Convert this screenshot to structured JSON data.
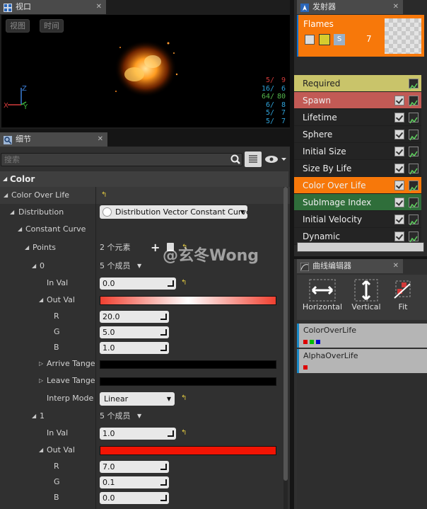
{
  "viewport": {
    "tab": "视口",
    "btn_view": "视图",
    "btn_time": "时间",
    "stats": [
      [
        "5/",
        "9",
        "#d23a3a"
      ],
      [
        "16/",
        "6",
        "#2fa3d9"
      ],
      [
        "64/",
        "80",
        "#54b84d"
      ],
      [
        "6/",
        "8",
        "#2fa3d9"
      ],
      [
        "5/",
        "7",
        "#2fa3d9"
      ],
      [
        "5/",
        "7",
        "#2fa3d9"
      ]
    ]
  },
  "details": {
    "tab": "细节",
    "search_placeholder": "搜索",
    "category": "Color",
    "color_over_life": "Color Over Life",
    "distribution": "Distribution",
    "distribution_value": "Distribution Vector Constant Curve",
    "constant_curve": "Constant Curve",
    "points": "Points",
    "points_value": "2 个元素",
    "p0": {
      "index": "0",
      "members": "5 个成员",
      "in_val_label": "In Val",
      "in_val": "0.0",
      "out_val_label": "Out Val",
      "r_label": "R",
      "r": "20.0",
      "g_label": "G",
      "g": "5.0",
      "b_label": "B",
      "b": "1.0",
      "arrive": "Arrive Tangent",
      "leave": "Leave Tangent",
      "interp_label": "Interp Mode",
      "interp": "Linear"
    },
    "p1": {
      "index": "1",
      "members": "5 个成员",
      "in_val_label": "In Val",
      "in_val": "1.0",
      "out_val_label": "Out Val",
      "r_label": "R",
      "r": "7.0",
      "g_label": "G",
      "g": "0.1",
      "b_label": "B",
      "b": "0.0"
    }
  },
  "emitter": {
    "tab": "发射器",
    "name": "Flames",
    "count": "7",
    "s_badge": "S",
    "modules": [
      "Required",
      "Spawn",
      "Lifetime",
      "Sphere",
      "Initial Size",
      "Size By Life",
      "Color Over Life",
      "SubImage Index",
      "Initial Velocity",
      "Dynamic"
    ]
  },
  "curve_editor": {
    "tab": "曲线编辑器",
    "horizontal": "Horizontal",
    "vertical": "Vertical",
    "fit": "Fit",
    "tracks": [
      "ColorOverLife",
      "AlphaOverLife"
    ]
  },
  "watermark": "@玄冬Wong",
  "colors": {
    "module_required": "#c9c46a",
    "module_spawn": "#c25a55",
    "module_selected": "#f7780a",
    "module_subimage": "#2f6e3a",
    "accent": "#f7780a"
  }
}
